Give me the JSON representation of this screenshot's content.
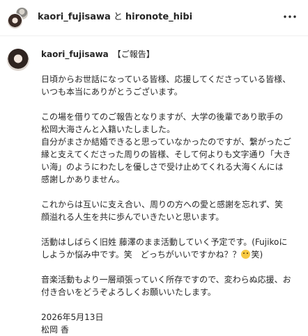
{
  "header": {
    "user1": "kaori_fujisawa",
    "conjunction": "と",
    "user2": "hironote_hibi"
  },
  "post": {
    "username": "kaori_fujisawa",
    "title": "【ご報告】",
    "p1": [
      "日頃からお世話になっている皆様、応援してくださっている皆様、",
      "いつも本当にありがとうございます。"
    ],
    "p2": [
      "この場を借りてのご報告となりますが、大学の後輩であり歌手の",
      "松岡大海さんと入籍いたしました。",
      "自分がまさか結婚できると思っていなかったのですが、繋がったご",
      "縁と支えてくださった周りの皆様、そして何よりも文字通り「大き",
      "い海」のようにわたしを優しさで受け止めてくれる大海くんには",
      "感謝しかありません。"
    ],
    "p3": [
      "これからは互いに支え合い、周りの方への愛と感謝を忘れず、笑",
      "顔溢れる人生を共に歩んでいきたいと思います。"
    ],
    "p4_line1": "活動はしばらく旧姓 藤澤のまま活動していく予定です。(Fujikoに",
    "p4_line2_pre": "しようか悩み中です。笑　どっちがいいですかね？？",
    "p4_line2_post": "笑)",
    "p5": [
      "音楽活動もより一層頑張っていく所存ですので、変わらぬ応援、お",
      "付き合いをどうぞよろしくお願いいたします。"
    ],
    "date": "2026年5月13日",
    "signature": "松岡 香"
  },
  "icons": {
    "more": "more-horizontal-icon",
    "emoji": "smiling-face-emoji"
  }
}
